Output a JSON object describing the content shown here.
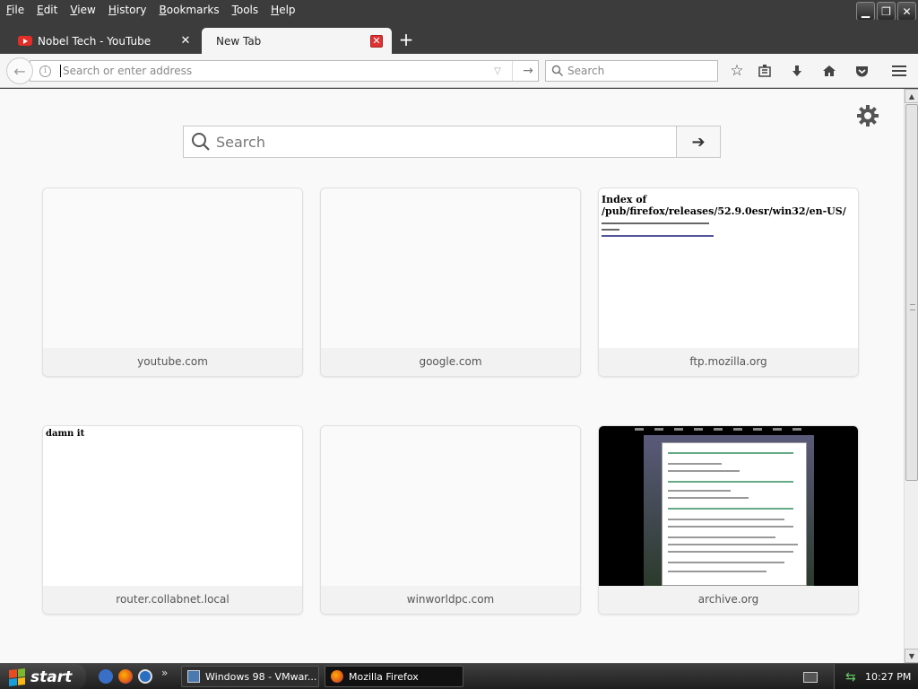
{
  "menu": {
    "items": [
      {
        "label": "File",
        "u": "F",
        "rest": "ile"
      },
      {
        "label": "Edit",
        "u": "E",
        "rest": "dit"
      },
      {
        "label": "View",
        "u": "V",
        "rest": "iew"
      },
      {
        "label": "History",
        "u": "H",
        "rest": "istory"
      },
      {
        "label": "Bookmarks",
        "u": "B",
        "rest": "ookmarks"
      },
      {
        "label": "Tools",
        "u": "T",
        "rest": "ools"
      },
      {
        "label": "Help",
        "u": "H",
        "rest": "elp"
      }
    ]
  },
  "tabs": [
    {
      "title": "Nobel Tech - YouTube",
      "icon": "youtube-icon",
      "active": false
    },
    {
      "title": "New Tab",
      "icon": "none",
      "active": true
    }
  ],
  "navbar": {
    "url_placeholder": "Search or enter address",
    "search_placeholder": "Search"
  },
  "newtab": {
    "search_placeholder": "Search",
    "tiles": [
      {
        "label": "youtube.com"
      },
      {
        "label": "google.com"
      },
      {
        "label": "ftp.mozilla.org",
        "preview_title": "Index of /pub/firefox/releases/52.9.0esr/win32/en-US/"
      },
      {
        "label": "router.collabnet.local",
        "preview_text": "damn it"
      },
      {
        "label": "winworldpc.com"
      },
      {
        "label": "archive.org"
      }
    ]
  },
  "taskbar": {
    "start_label": "start",
    "tasks": [
      {
        "label": "Windows 98 - VMwar..."
      },
      {
        "label": "Mozilla Firefox"
      }
    ],
    "clock": "10:27 PM"
  },
  "colors": {
    "chrome_dark": "#3c3c3c",
    "toolbar": "#f5f5f5",
    "content_bg": "#f9f9f9",
    "close_red": "#dd3333"
  }
}
